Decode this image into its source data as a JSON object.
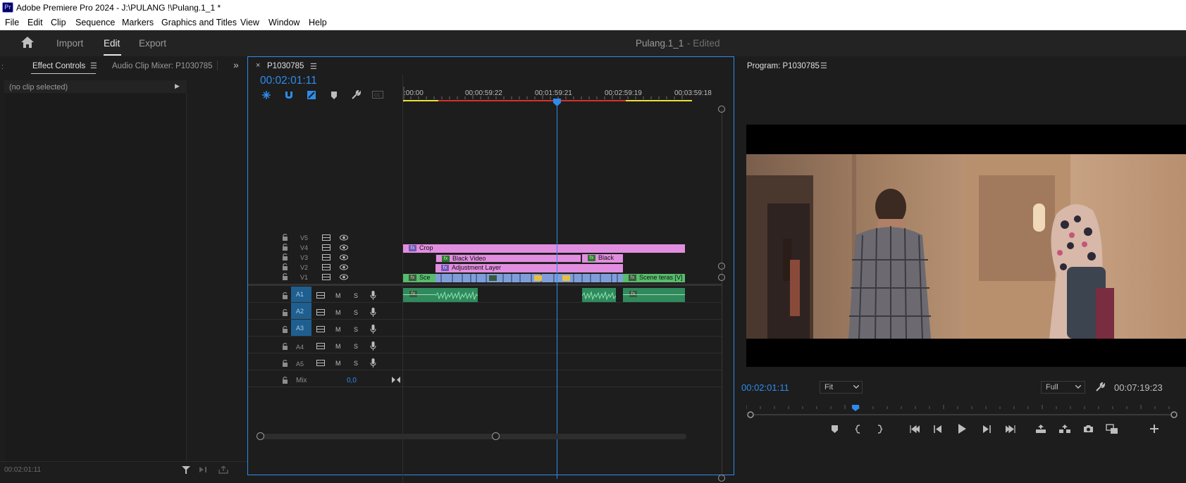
{
  "window": {
    "logo_text": "Pr",
    "title": "Adobe Premiere Pro 2024 - J:\\PULANG !\\Pulang.1_1 *"
  },
  "menu": [
    "File",
    "Edit",
    "Clip",
    "Sequence",
    "Markers",
    "Graphics and Titles",
    "View",
    "Window",
    "Help"
  ],
  "header": {
    "tabs": [
      "Import",
      "Edit",
      "Export"
    ],
    "active_tab": "Edit",
    "project_name": "Pulang.1_1",
    "edited_suffix": "- Edited"
  },
  "left_panel": {
    "tabs": [
      "Effect Controls",
      "Audio Clip Mixer: P1030785"
    ],
    "clip_selector": "(no clip selected)",
    "timecode": "00:02:01:11"
  },
  "timeline": {
    "close_glyph": "×",
    "sequence_name": "P1030785",
    "timecode": "00:02:01:11",
    "ruler_labels": [
      ":00:00",
      "00:00:59:22",
      "00:01:59:21",
      "00:02:59:19",
      "00:03:59:18"
    ],
    "video_tracks": [
      "V5",
      "V4",
      "V3",
      "V2",
      "V1"
    ],
    "audio_tracks": [
      "A1",
      "A2",
      "A3",
      "A4",
      "A5"
    ],
    "mute_label": "M",
    "solo_label": "S",
    "mix_label": "Mix",
    "mix_value": "0,0",
    "clips": {
      "v4_crop": "Crop",
      "v3_black_video": "Black Video",
      "v3_black": "Black",
      "v2_adjustment": "Adjustment Layer",
      "v1_first": "Sce",
      "v1_last": "Scene teras [V]"
    }
  },
  "program_monitor": {
    "title": "Program: P1030785",
    "timecode": "00:02:01:11",
    "fit": "Fit",
    "resolution": "Full",
    "duration": "00:07:19:23"
  },
  "colors": {
    "accent_blue": "#2d8ceb",
    "clip_pink": "#e28ee0",
    "clip_blue": "#7f9ed9",
    "clip_green": "#57bc6b",
    "audio_green": "#2f8a5c"
  }
}
